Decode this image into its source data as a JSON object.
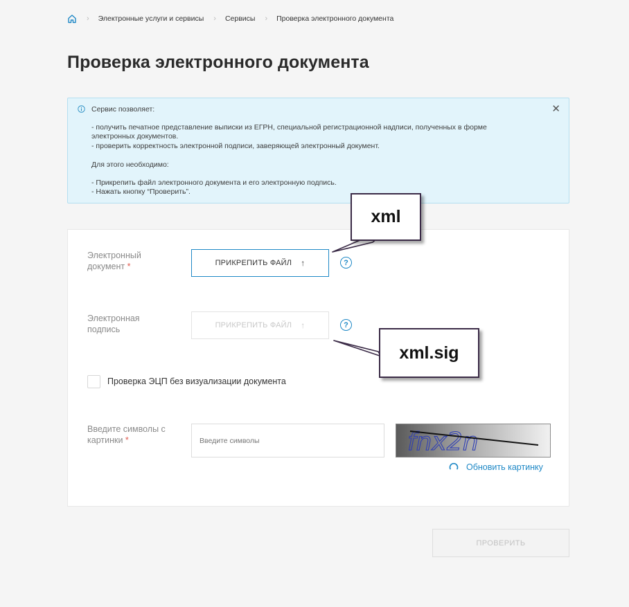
{
  "breadcrumb": {
    "items": [
      "Электронные услуги и сервисы",
      "Сервисы",
      "Проверка электронного документа"
    ]
  },
  "page_title": "Проверка электронного документа",
  "info": {
    "heading": "Сервис позволяет:",
    "line1": "- получить печатное представление выписки из ЕГРН, специальной регистрационной надписи, полученных в форме",
    "line2": "электронных документов.",
    "line3": "- проверить корректность электронной подписи, заверяющей электронный документ.",
    "line4": "Для этого необходимо:",
    "line5": "- Прикрепить файл электронного документа и его электронную подпись.",
    "line6": "- Нажать кнопку “Проверить”.",
    "close": "✕"
  },
  "form": {
    "doc_label_1": "Электронный",
    "doc_label_2": "документ",
    "attach_label": "ПРИКРЕПИТЬ ФАЙЛ",
    "sig_label_1": "Электронная",
    "sig_label_2": "подпись",
    "help": "?",
    "checkbox_label": "Проверка ЭЦП без визуализации документа",
    "captcha_label_1": "Введите символы с",
    "captcha_label_2": "картинки",
    "captcha_placeholder": "Введите символы",
    "captcha_text": "fnx2n",
    "refresh_label": "Обновить картинку",
    "required_mark": "*",
    "upload_icon": "↑"
  },
  "submit_label": "ПРОВЕРИТЬ",
  "callouts": {
    "first": "xml",
    "second": "xml.sig"
  },
  "colors": {
    "accent": "#1e88c6",
    "info_bg": "#e2f4fb",
    "required": "#e05a4f"
  }
}
